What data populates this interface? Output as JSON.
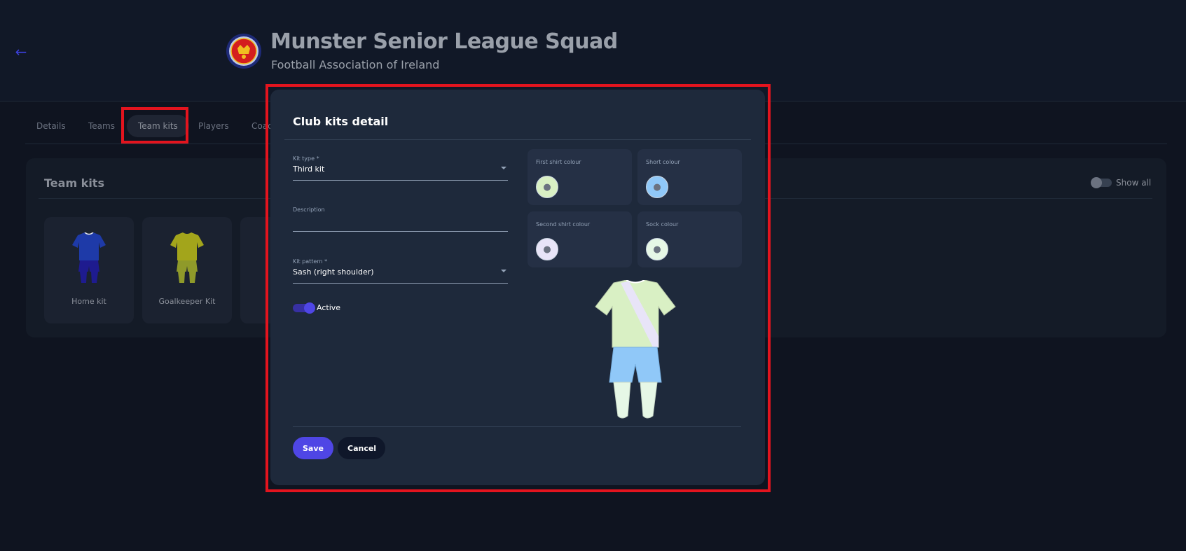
{
  "header": {
    "back_icon": "arrow-left-icon",
    "club_name": "Munster Senior League Squad",
    "association": "Football Association of Ireland"
  },
  "tabs": [
    {
      "label": "Details"
    },
    {
      "label": "Teams"
    },
    {
      "label": "Team kits",
      "active": true
    },
    {
      "label": "Players"
    },
    {
      "label": "Coac"
    }
  ],
  "panel": {
    "title": "Team kits",
    "show_all_label": "Show all",
    "kits": [
      {
        "label": "Home kit",
        "shirt": "#1e3aa8",
        "shorts": "#1e1b8f",
        "socks": "#1e1b8f"
      },
      {
        "label": "Goalkeeper Kit",
        "shirt": "#a3a51b",
        "shorts": "#8f9a2a",
        "socks": "#8f9a2a"
      }
    ]
  },
  "modal": {
    "title": "Club kits detail",
    "kit_type": {
      "label": "Kit type *",
      "value": "Third kit"
    },
    "description": {
      "label": "Description",
      "value": ""
    },
    "kit_pattern": {
      "label": "Kit pattern *",
      "value": "Sash (right shoulder)"
    },
    "active_label": "Active",
    "active": true,
    "swatches": {
      "first_shirt": {
        "label": "First shirt colour",
        "color": "#d9f0c4"
      },
      "short": {
        "label": "Short colour",
        "color": "#90c8f8"
      },
      "second_shirt": {
        "label": "Second shirt colour",
        "color": "#e8e4f8"
      },
      "sock": {
        "label": "Sock colour",
        "color": "#e6f7e6"
      }
    },
    "save_label": "Save",
    "cancel_label": "Cancel"
  },
  "colors": {
    "accent": "#4f46e5",
    "highlight": "#e3141e"
  }
}
